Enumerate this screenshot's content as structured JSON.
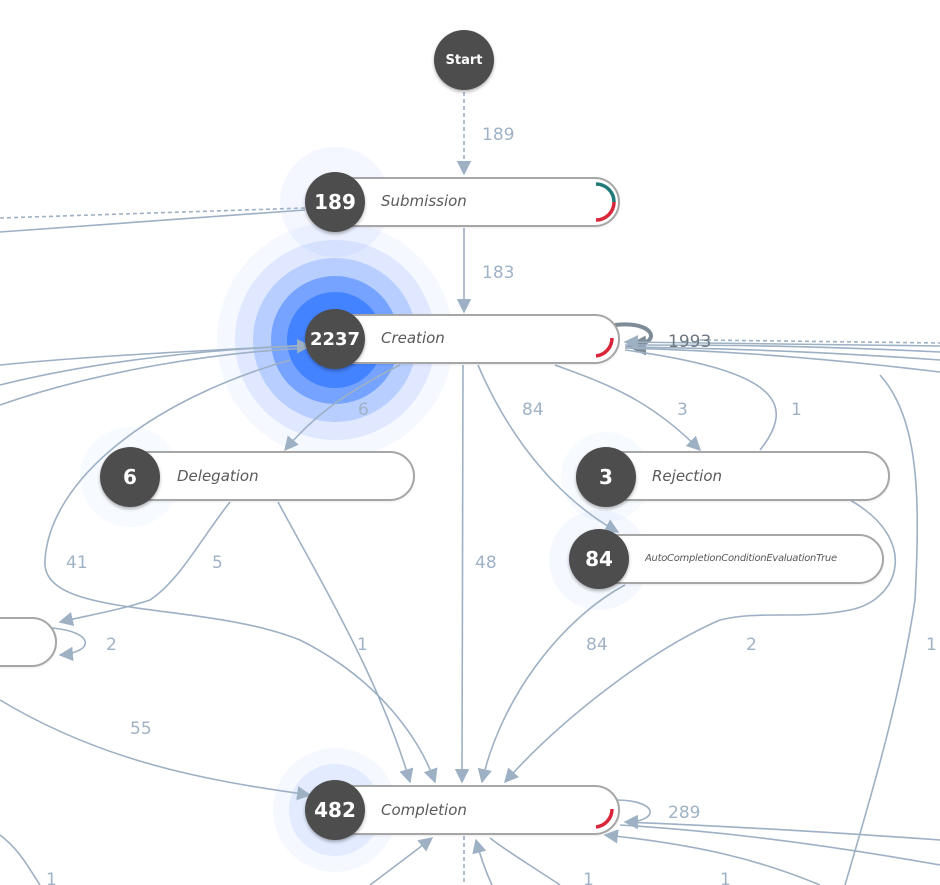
{
  "colors": {
    "edge": "#9db0c4",
    "node_circle": "#4d4d4d",
    "pill_border": "#a6a6a6",
    "highlight_blue": "#3f7fff",
    "status_teal": "#1f7a78",
    "status_red": "#d9263a"
  },
  "nodes": {
    "start": {
      "label": "Start"
    },
    "submission": {
      "count": "189",
      "label": "Submission"
    },
    "creation": {
      "count": "2237",
      "label": "Creation"
    },
    "delegation": {
      "count": "6",
      "label": "Delegation"
    },
    "rejection": {
      "count": "3",
      "label": "Rejection"
    },
    "autocompletion": {
      "count": "84",
      "label": "AutoCompletionConditionEvaluationTrue"
    },
    "completion": {
      "count": "482",
      "label": "Completion"
    }
  },
  "edge_labels": {
    "start_submission": "189",
    "submission_creation": "183",
    "creation_self": "1993",
    "creation_delegation": "6",
    "creation_autocompletion": "84",
    "creation_rejection": "3",
    "rejection_creation": "1",
    "left_loop_41": "41",
    "delegation_left": "5",
    "creation_completion": "48",
    "left_self": "2",
    "delegation_completion": "1",
    "autocompletion_completion": "84",
    "rejection_completion": "2",
    "right_edge_1": "1",
    "left_completion": "55",
    "completion_self": "289",
    "bottom_left_1": "1",
    "bottom_mid_1": "1",
    "bottom_right_1": "1"
  }
}
